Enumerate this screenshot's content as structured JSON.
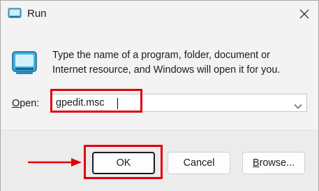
{
  "window": {
    "title": "Run"
  },
  "description": "Type the name of a program, folder, document or\nInternet resource, and Windows will open it for you.",
  "open_field": {
    "label_prefix": "",
    "label_mnemonic": "O",
    "label_rest": "pen:",
    "value": "gpedit.msc"
  },
  "buttons": {
    "ok": "OK",
    "cancel": "Cancel",
    "browse_mnemonic": "B",
    "browse_rest": "rowse..."
  },
  "icons": {
    "app": "run-icon",
    "close": "close-icon",
    "dropdown": "chevron-down-icon",
    "pointer": "red-arrow-icon"
  },
  "colors": {
    "highlight": "#e10009",
    "background": "#f3f3f3",
    "accent_icon": "#2aa7dc"
  }
}
